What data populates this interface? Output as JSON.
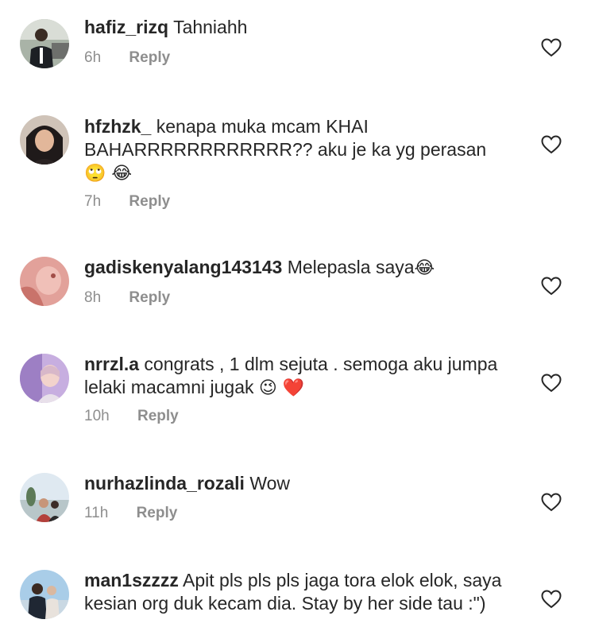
{
  "reply_label": "Reply",
  "comments": [
    {
      "username": "hafiz_rizq",
      "text": "Tahniahh",
      "emoji": "",
      "time": "6h"
    },
    {
      "username": "hfzhzk_",
      "text": "kenapa muka mcam KHAI BAHARRRRRRRRRRRR?? aku je ka yg perasan",
      "emoji": "🙄 😂",
      "time": "7h"
    },
    {
      "username": "gadiskenyalang143143",
      "text": "Melepasla saya",
      "emoji": "😂",
      "time": "8h"
    },
    {
      "username": "nrrzl.a",
      "text": "congrats , 1 dlm sejuta . semoga aku jumpa lelaki macamni jugak",
      "emoji": "😉 ❤️",
      "time": "10h"
    },
    {
      "username": "nurhazlinda_rozali",
      "text": "Wow",
      "emoji": "",
      "time": "11h"
    },
    {
      "username": "man1szzzz",
      "text": "Apit pls pls pls jaga tora elok elok, saya kesian org duk kecam dia. Stay by her side tau :\")",
      "emoji": "",
      "time": ""
    }
  ]
}
